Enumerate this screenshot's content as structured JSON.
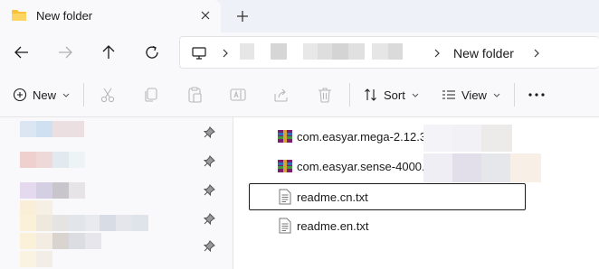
{
  "tab": {
    "title": "New folder",
    "close_icon": "close-icon",
    "new_tab_icon": "plus-icon"
  },
  "nav": {
    "back_icon": "arrow-left-icon",
    "forward_icon": "arrow-right-icon",
    "up_icon": "arrow-up-icon",
    "refresh_icon": "refresh-icon",
    "breadcrumb_current": "New folder"
  },
  "toolbar": {
    "new_label": "New",
    "sort_label": "Sort",
    "view_label": "View",
    "more_icon": "more-icon"
  },
  "files": [
    {
      "name": "com.easyar.mega-2.12.3+4",
      "icon": "archive-icon"
    },
    {
      "name": "com.easyar.sense-4000.0.0+",
      "icon": "archive-icon"
    },
    {
      "name": "readme.cn.txt",
      "icon": "text-file-icon"
    },
    {
      "name": "readme.en.txt",
      "icon": "text-file-icon"
    }
  ],
  "colors": {
    "accent": "#0067c0",
    "folder": "#f8c23a",
    "chrome": "#eef1f7",
    "surface": "#f9f9fb"
  }
}
